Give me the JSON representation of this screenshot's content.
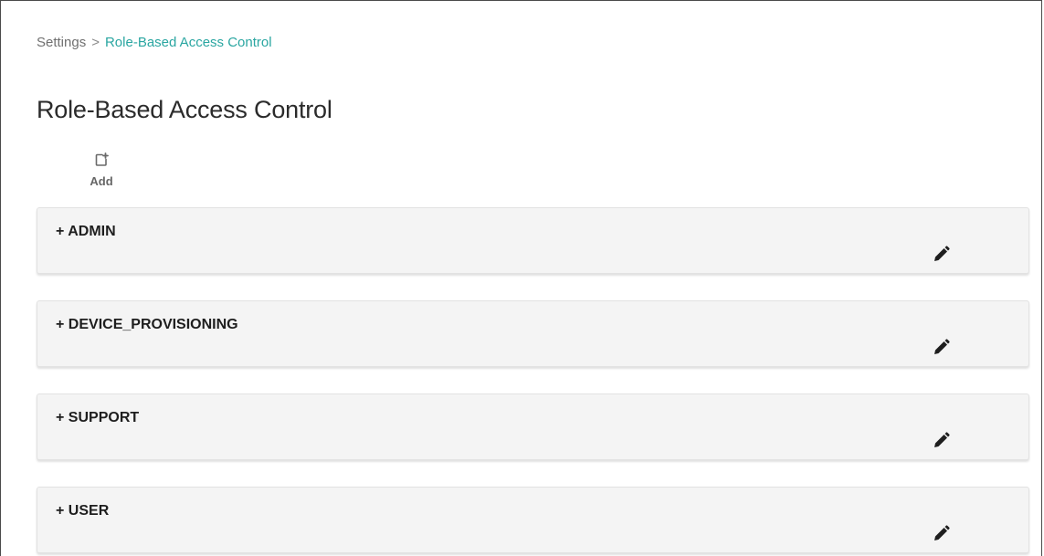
{
  "breadcrumb": {
    "root": "Settings",
    "separator": ">",
    "current": "Role-Based Access Control"
  },
  "page": {
    "title": "Role-Based Access Control"
  },
  "toolbar": {
    "add_label": "Add",
    "add_icon": "add-document-icon"
  },
  "roles": [
    {
      "prefix": "+",
      "name": "ADMIN",
      "edit_icon": "pencil-icon"
    },
    {
      "prefix": "+",
      "name": "DEVICE_PROVISIONING",
      "edit_icon": "pencil-icon"
    },
    {
      "prefix": "+",
      "name": "SUPPORT",
      "edit_icon": "pencil-icon"
    },
    {
      "prefix": "+",
      "name": "USER",
      "edit_icon": "pencil-icon"
    }
  ],
  "colors": {
    "link_accent": "#2aa6a1",
    "card_background": "#f4f4f4",
    "title_text": "#2b2b2b"
  }
}
